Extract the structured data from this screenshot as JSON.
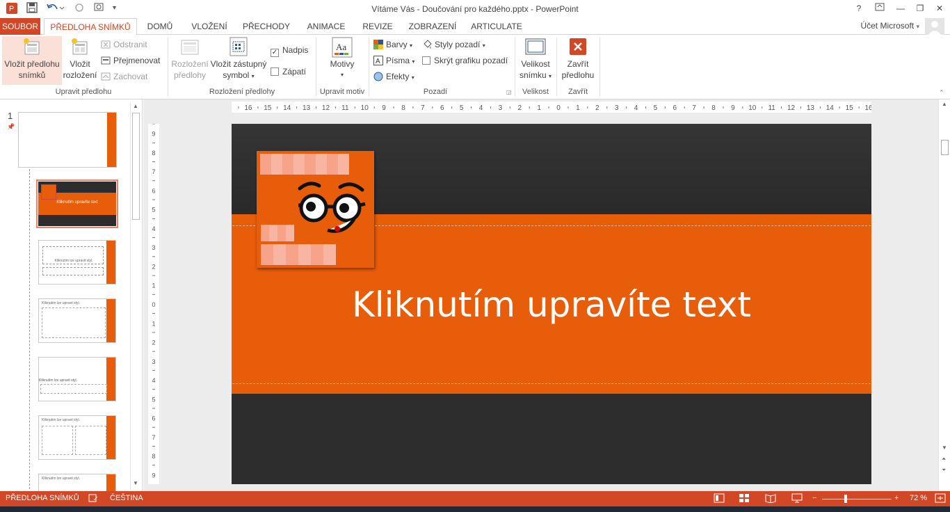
{
  "window": {
    "title": "Vítáme Vás - Doučování pro každého.pptx - PowerPoint",
    "help": "?",
    "minimize": "—",
    "restore": "❐",
    "close": "✕"
  },
  "tabs": [
    {
      "label": "SOUBOR"
    },
    {
      "label": "PŘEDLOHA SNÍMKŮ"
    },
    {
      "label": "DOMŮ"
    },
    {
      "label": "VLOŽENÍ"
    },
    {
      "label": "PŘECHODY"
    },
    {
      "label": "ANIMACE"
    },
    {
      "label": "REVIZE"
    },
    {
      "label": "ZOBRAZENÍ"
    },
    {
      "label": "ARTICULATE"
    }
  ],
  "account": "Účet Microsoft",
  "ribbon": {
    "edit_master": {
      "insert_master_line1": "Vložit předlohu",
      "insert_master_line2": "snímků",
      "insert_layout_line1": "Vložit",
      "insert_layout_line2": "rozložení",
      "delete": "Odstranit",
      "rename": "Přejmenovat",
      "preserve": "Zachovat",
      "label": "Upravit předlohu"
    },
    "master_layout": {
      "layout_line1": "Rozložení",
      "layout_line2": "předlohy",
      "placeholder_line1": "Vložit zástupný",
      "placeholder_line2": "symbol",
      "title_check": "Nadpis",
      "footer_check": "Zápatí",
      "label": "Rozložení předlohy"
    },
    "edit_theme": {
      "themes": "Motivy",
      "label": "Upravit motiv"
    },
    "background": {
      "colors": "Barvy",
      "fonts": "Písma",
      "effects": "Efekty",
      "bg_styles": "Styly pozadí",
      "hide_bg": "Skrýt grafiku pozadí",
      "label": "Pozadí"
    },
    "size": {
      "line1": "Velikost",
      "line2": "snímku",
      "label": "Velikost"
    },
    "close": {
      "line1": "Zavřít",
      "line2": "předlohu",
      "label": "Zavřít"
    }
  },
  "thumbnails": {
    "number": "1",
    "title_text": "Kliknutím upravíte text",
    "style_text": "Kliknutím lze upravit styl."
  },
  "ruler": {
    "h_labels": [
      "16",
      "15",
      "14",
      "13",
      "12",
      "11",
      "10",
      "9",
      "8",
      "7",
      "6",
      "5",
      "4",
      "3",
      "2",
      "1",
      "0",
      "1",
      "2",
      "3",
      "4",
      "5",
      "6",
      "7",
      "8",
      "9",
      "10",
      "11",
      "12",
      "13",
      "14",
      "15",
      "16"
    ],
    "v_labels": [
      "9",
      "8",
      "7",
      "6",
      "5",
      "4",
      "3",
      "2",
      "1",
      "0",
      "1",
      "2",
      "3",
      "4",
      "5",
      "6",
      "7",
      "8",
      "9"
    ]
  },
  "slide": {
    "title": "Kliknutím upravíte text"
  },
  "status": {
    "view": "PŘEDLOHA SNÍMKŮ",
    "language": "ČEŠTINA",
    "zoom": "72 %",
    "minus": "−",
    "plus": "+"
  },
  "colors": {
    "accent": "#d24726",
    "slide_orange": "#e85d0a",
    "slide_dark": "#2d2d2d"
  }
}
